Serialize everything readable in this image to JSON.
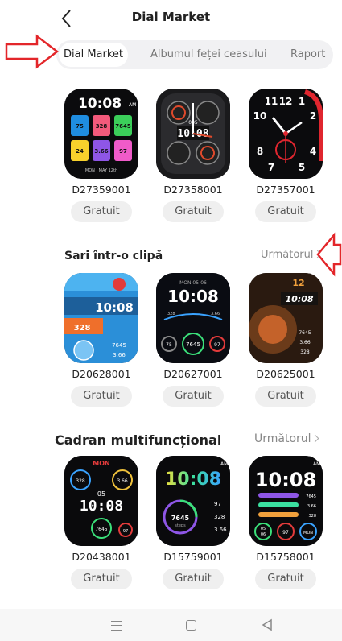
{
  "header": {
    "title": "Dial Market"
  },
  "tabs": [
    {
      "label": "Dial Market",
      "active": true
    },
    {
      "label": "Albumul feței ceasului",
      "active": false
    },
    {
      "label": "Raport",
      "active": false
    }
  ],
  "sections": [
    {
      "title": "",
      "more": "",
      "items": [
        {
          "code": "D27359001",
          "button": "Gratuit"
        },
        {
          "code": "D27358001",
          "button": "Gratuit"
        },
        {
          "code": "D27357001",
          "button": "Gratuit"
        }
      ]
    },
    {
      "title": "Sari într-o clipă",
      "more": "Următorul",
      "items": [
        {
          "code": "D20628001",
          "button": "Gratuit"
        },
        {
          "code": "D20627001",
          "button": "Gratuit"
        },
        {
          "code": "D20625001",
          "button": "Gratuit"
        }
      ]
    },
    {
      "title": "Cadran multifuncțional",
      "more": "Următorul",
      "items": [
        {
          "code": "D20438001",
          "button": "Gratuit"
        },
        {
          "code": "D15759001",
          "button": "Gratuit"
        },
        {
          "code": "D15758001",
          "button": "Gratuit"
        }
      ]
    }
  ],
  "dials": {
    "d1": {
      "time": "10:08",
      "ampm": "AM",
      "stats": [
        "75",
        "328",
        "7645",
        "24",
        "3.66",
        "97"
      ],
      "date": "MON , MAY 12th"
    },
    "d2": {
      "time": "10:08",
      "num": "005"
    },
    "d3": {
      "numerals": [
        "11",
        "12",
        "1",
        "10",
        "2",
        "8",
        "4",
        "7",
        "5"
      ]
    },
    "d4": {
      "time": "10:08",
      "stat1": "328",
      "stat2": "7645",
      "stat3": "3.66"
    },
    "d5": {
      "time": "10:08",
      "date": "MON 05-06",
      "stat1": "328",
      "stat2": "3.66",
      "stat3": "7645",
      "stat4": "97",
      "stat5": "75"
    },
    "d6": {
      "hour": "12",
      "time": "10:08",
      "stat1": "7645",
      "stat2": "3.66",
      "stat3": "328"
    },
    "d7": {
      "time": "10:08",
      "day": "MON",
      "date": "05",
      "stat1": "328",
      "stat2": "3.66",
      "stat3": "7645",
      "stat4": "97"
    },
    "d8": {
      "time": "10:08",
      "ampm": "AM",
      "steps": "7645",
      "steps_label": "steps",
      "stat1": "97",
      "stat2": "328",
      "stat3": "3.66"
    },
    "d9": {
      "time": "10:08",
      "ampm": "AM",
      "stat1": "7645",
      "stat2": "3.66",
      "stat3": "328",
      "d1": "05",
      "d2": "06",
      "d3": "97",
      "day": "MON"
    }
  },
  "colors": {
    "accent_arrow": "#e3262a",
    "tab_bg": "#f1f1f3",
    "button_bg": "#efefef"
  }
}
